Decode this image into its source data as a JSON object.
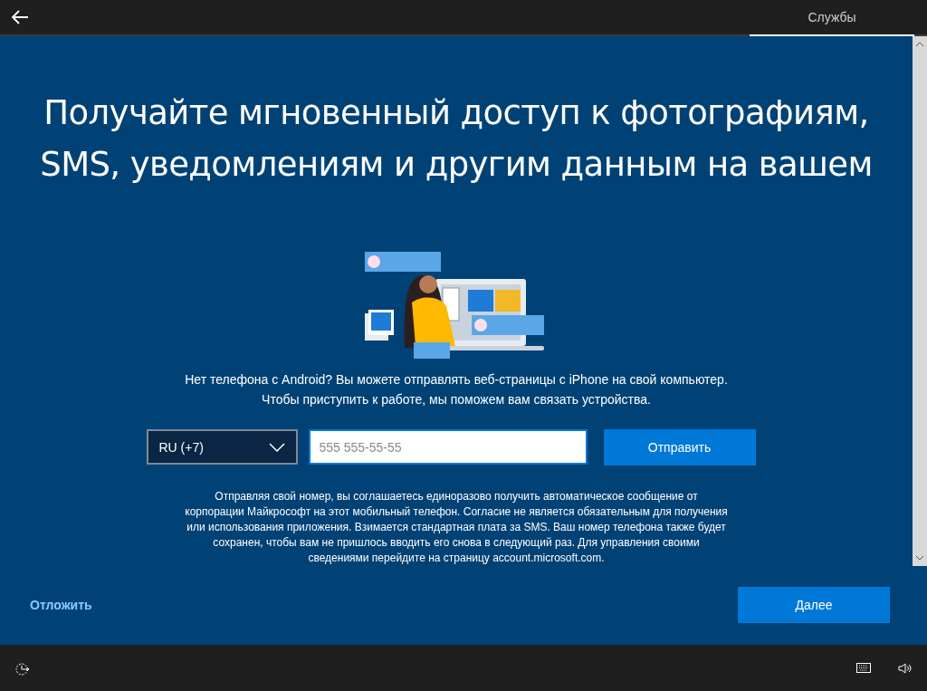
{
  "top_bar": {
    "tabs": [
      {
        "label": "Службы",
        "selected": true
      }
    ]
  },
  "heading": "Получайте мгновенный доступ к фотографиям, SMS, уведомлениям и другим данным на вашем",
  "description": "Нет телефона с Android? Вы можете отправлять веб-страницы с iPhone на свой компьютер. Чтобы приступить к работе, мы поможем вам связать устройства.",
  "form": {
    "country": "RU (+7)",
    "phone": {
      "placeholder": "555 555-55-55"
    },
    "send_button": "Отправить"
  },
  "disclaimer": "Отправляя свой номер, вы соглашаетесь единоразово получить автоматическое сообщение от корпорации Майкрософт на этот мобильный телефон. Согласие не является обязательным для получения или использования приложения. Взимается стандартная плата за SMS. Ваш номер телефона также будет сохранен, чтобы вам не пришлось вводить его снова в следующий раз. Для управления своими сведениями перейдите на страницу account.microsoft.com.",
  "footer": {
    "skip_link": "Отложить",
    "next_button": "Далее"
  }
}
